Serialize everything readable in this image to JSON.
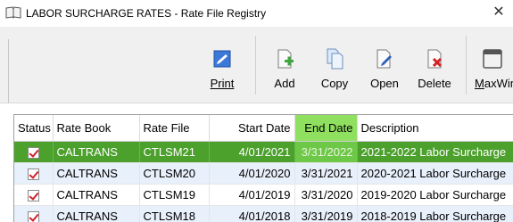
{
  "window": {
    "title": "LABOR SURCHARGE RATES - Rate File Registry",
    "close_glyph": "✕"
  },
  "toolbar": {
    "buttons": [
      {
        "label": "Print",
        "icon": "print-icon"
      },
      {
        "label": "Add",
        "icon": "add-document-icon"
      },
      {
        "label": "Copy",
        "icon": "copy-documents-icon"
      },
      {
        "label": "Open",
        "icon": "open-document-icon"
      },
      {
        "label": "Delete",
        "icon": "delete-document-icon"
      },
      {
        "label": "MaxWin",
        "icon": "maximize-window-icon"
      }
    ]
  },
  "grid": {
    "columns": [
      "Status",
      "Rate Book",
      "Rate File",
      "Start Date",
      "End Date",
      "Description"
    ],
    "sorted_column": "End Date",
    "rows": [
      {
        "status_checked": true,
        "rate_book": "CALTRANS",
        "rate_file": "CTLSM21",
        "start_date": "4/01/2021",
        "end_date": "3/31/2022",
        "description": "2021-2022 Labor Surcharge"
      },
      {
        "status_checked": true,
        "rate_book": "CALTRANS",
        "rate_file": "CTLSM20",
        "start_date": "4/01/2020",
        "end_date": "3/31/2021",
        "description": "2020-2021 Labor Surcharge"
      },
      {
        "status_checked": true,
        "rate_book": "CALTRANS",
        "rate_file": "CTLSM19",
        "start_date": "4/01/2019",
        "end_date": "3/31/2020",
        "description": "2019-2020 Labor Surcharge"
      },
      {
        "status_checked": true,
        "rate_book": "CALTRANS",
        "rate_file": "CTLSM18",
        "start_date": "4/01/2018",
        "end_date": "3/31/2019",
        "description": "2018-2019 Labor Surcharge"
      }
    ]
  },
  "colors": {
    "selected_row": "#4ca02c",
    "sorted_header": "#90e060",
    "alt_row": "#e8f0fb",
    "check_mark": "#d0202a"
  }
}
